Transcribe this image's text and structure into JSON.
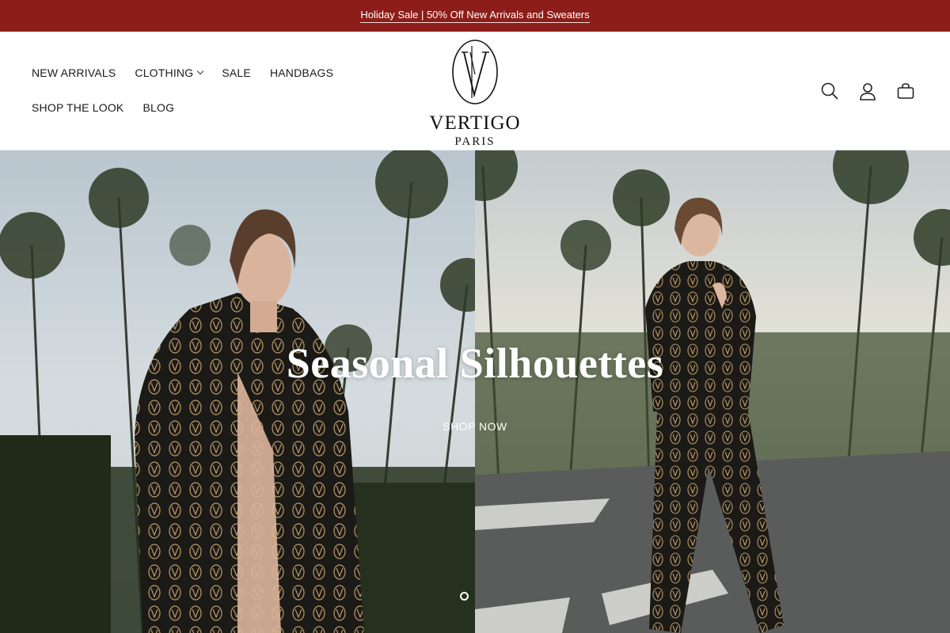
{
  "announcement": {
    "text": "Holiday Sale | 50% Off New Arrivals and Sweaters",
    "background": "#8C1D18"
  },
  "nav": {
    "row1": [
      {
        "label": "NEW ARRIVALS"
      },
      {
        "label": "CLOTHING"
      },
      {
        "label": "SALE"
      },
      {
        "label": "HANDBAGS"
      }
    ],
    "row2": [
      {
        "label": "SHOP THE LOOK"
      },
      {
        "label": "BLOG"
      }
    ]
  },
  "logo": {
    "word": "VERTIGO",
    "sub": "PARIS"
  },
  "header_icons": [
    "search-icon",
    "account-icon",
    "cart-icon"
  ],
  "hero": {
    "title": "Seasonal Silhouettes",
    "cta": "SHOP NOW",
    "slide_count": 1,
    "active_slide": 1
  }
}
